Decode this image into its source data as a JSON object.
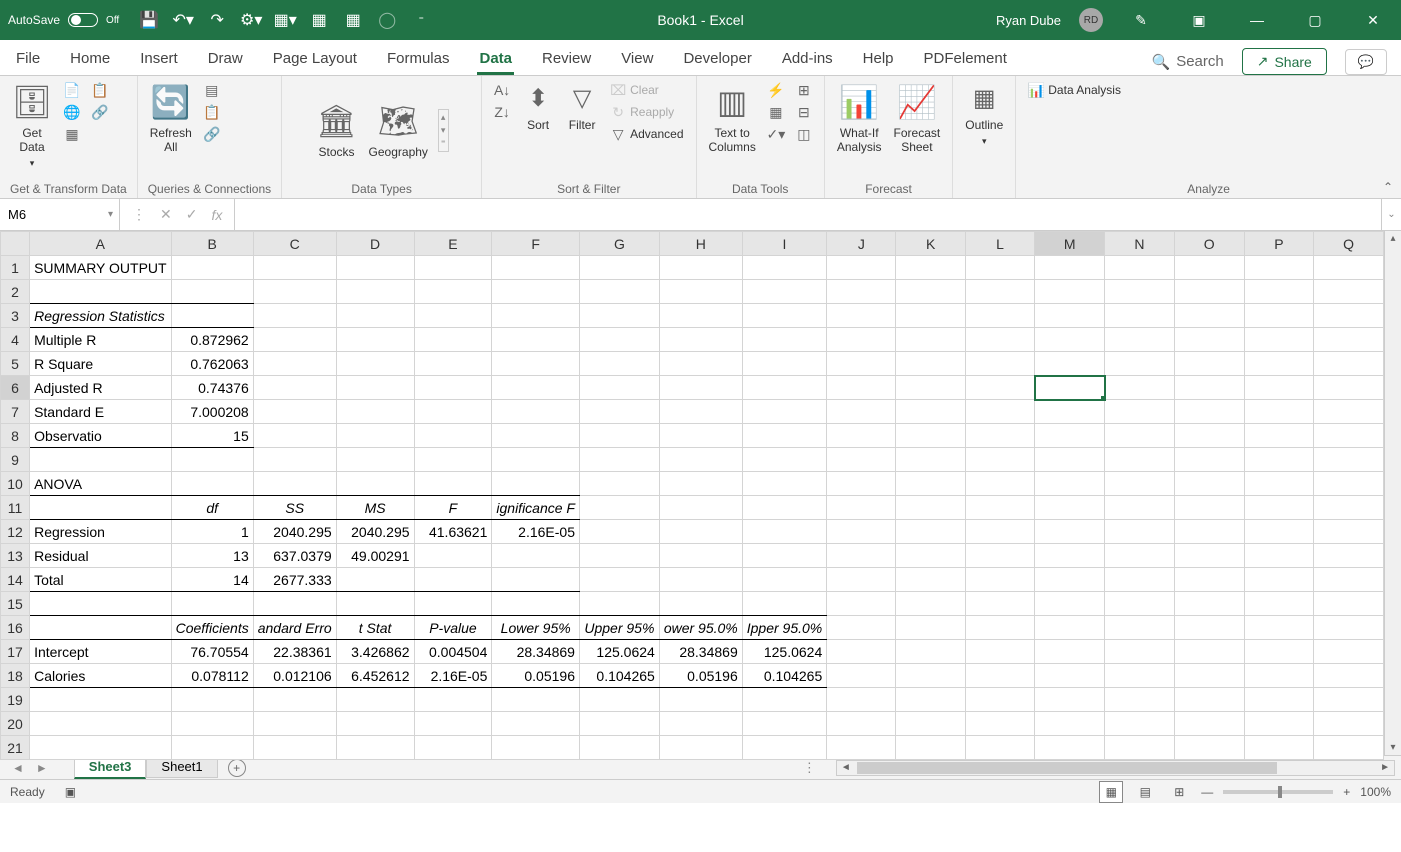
{
  "titlebar": {
    "autosave_label": "AutoSave",
    "autosave_state": "Off",
    "doc_title": "Book1  -  Excel",
    "user_name": "Ryan Dube",
    "user_initials": "RD"
  },
  "tabs": {
    "items": [
      "File",
      "Home",
      "Insert",
      "Draw",
      "Page Layout",
      "Formulas",
      "Data",
      "Review",
      "View",
      "Developer",
      "Add-ins",
      "Help",
      "PDFelement"
    ],
    "active": "Data",
    "search": "Search",
    "share": "Share"
  },
  "ribbon": {
    "groups": {
      "get_transform": {
        "label": "Get & Transform Data",
        "get_data": "Get\nData"
      },
      "queries": {
        "label": "Queries & Connections",
        "refresh": "Refresh\nAll"
      },
      "data_types": {
        "label": "Data Types",
        "stocks": "Stocks",
        "geography": "Geography"
      },
      "sort_filter": {
        "label": "Sort & Filter",
        "sort": "Sort",
        "filter": "Filter",
        "clear": "Clear",
        "reapply": "Reapply",
        "advanced": "Advanced"
      },
      "data_tools": {
        "label": "Data Tools",
        "text_to_cols": "Text to\nColumns"
      },
      "forecast": {
        "label": "Forecast",
        "whatif": "What-If\nAnalysis",
        "fsheet": "Forecast\nSheet"
      },
      "outline": {
        "label": "Outline",
        "outline_btn": "Outline"
      },
      "analyze": {
        "label": "Analyze",
        "data_analysis": "Data Analysis"
      }
    }
  },
  "formula_bar": {
    "cell_ref": "M6",
    "formula": ""
  },
  "grid": {
    "columns": [
      "A",
      "B",
      "C",
      "D",
      "E",
      "F",
      "G",
      "H",
      "I",
      "J",
      "K",
      "L",
      "M",
      "N",
      "O",
      "P",
      "Q"
    ],
    "selected_cell": "M6",
    "rows": [
      {
        "n": 1,
        "cells": {
          "A": "SUMMARY OUTPUT"
        }
      },
      {
        "n": 2,
        "cells": {}
      },
      {
        "n": 3,
        "cells": {
          "A": "Regression Statistics"
        },
        "italic": [
          "A"
        ]
      },
      {
        "n": 4,
        "cells": {
          "A": "Multiple R",
          "B": "0.872962"
        }
      },
      {
        "n": 5,
        "cells": {
          "A": "R Square",
          "B": "0.762063"
        }
      },
      {
        "n": 6,
        "cells": {
          "A": "Adjusted R",
          "B": "0.74376"
        }
      },
      {
        "n": 7,
        "cells": {
          "A": "Standard E",
          "B": "7.000208"
        }
      },
      {
        "n": 8,
        "cells": {
          "A": "Observatio",
          "B": "15"
        }
      },
      {
        "n": 9,
        "cells": {}
      },
      {
        "n": 10,
        "cells": {
          "A": "ANOVA"
        }
      },
      {
        "n": 11,
        "cells": {
          "B": "df",
          "C": "SS",
          "D": "MS",
          "E": "F",
          "F": "ignificance F"
        },
        "italic": [
          "B",
          "C",
          "D",
          "E",
          "F"
        ],
        "center": [
          "B",
          "C",
          "D",
          "E",
          "F"
        ]
      },
      {
        "n": 12,
        "cells": {
          "A": "Regression",
          "B": "1",
          "C": "2040.295",
          "D": "2040.295",
          "E": "41.63621",
          "F": "2.16E-05"
        }
      },
      {
        "n": 13,
        "cells": {
          "A": "Residual",
          "B": "13",
          "C": "637.0379",
          "D": "49.00291"
        }
      },
      {
        "n": 14,
        "cells": {
          "A": "Total",
          "B": "14",
          "C": "2677.333"
        }
      },
      {
        "n": 15,
        "cells": {}
      },
      {
        "n": 16,
        "cells": {
          "B": "Coefficients",
          "C": "andard Erro",
          "D": "t Stat",
          "E": "P-value",
          "F": "Lower 95%",
          "G": "Upper 95%",
          "H": "ower 95.0%",
          "I": "Ipper 95.0%"
        },
        "italic": [
          "B",
          "C",
          "D",
          "E",
          "F",
          "G",
          "H",
          "I"
        ],
        "center": [
          "B",
          "C",
          "D",
          "E",
          "F",
          "G",
          "H",
          "I"
        ]
      },
      {
        "n": 17,
        "cells": {
          "A": "Intercept",
          "B": "76.70554",
          "C": "22.38361",
          "D": "3.426862",
          "E": "0.004504",
          "F": "28.34869",
          "G": "125.0624",
          "H": "28.34869",
          "I": "125.0624"
        }
      },
      {
        "n": 18,
        "cells": {
          "A": "Calories",
          "B": "0.078112",
          "C": "0.012106",
          "D": "6.452612",
          "E": "2.16E-05",
          "F": "0.05196",
          "G": "0.104265",
          "H": "0.05196",
          "I": "0.104265"
        }
      },
      {
        "n": 19,
        "cells": {}
      },
      {
        "n": 20,
        "cells": {}
      },
      {
        "n": 21,
        "cells": {}
      }
    ]
  },
  "sheets": {
    "tabs": [
      "Sheet3",
      "Sheet1"
    ],
    "active": "Sheet3"
  },
  "status": {
    "ready": "Ready",
    "zoom": "100%"
  }
}
